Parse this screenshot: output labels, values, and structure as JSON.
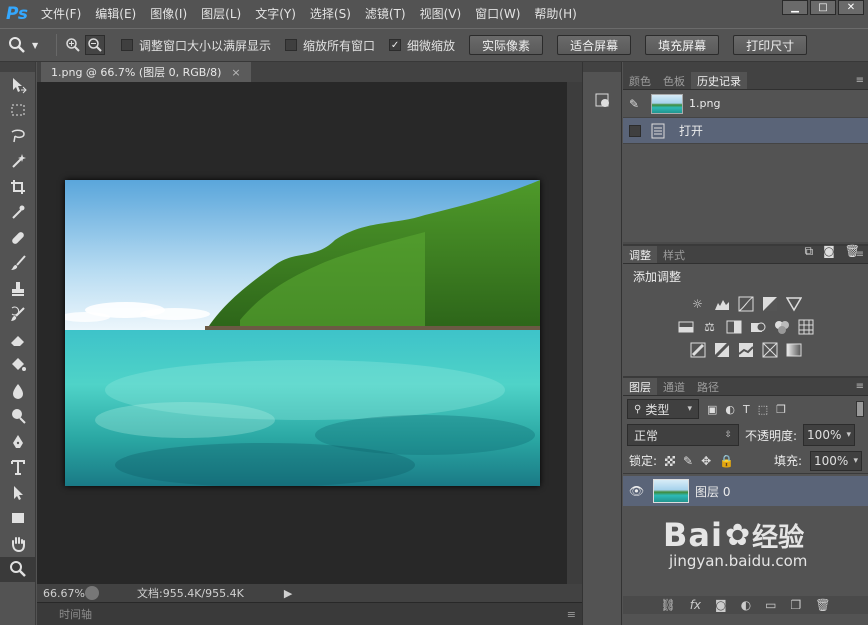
{
  "app": {
    "logo": "Ps"
  },
  "menu": [
    "文件(F)",
    "编辑(E)",
    "图像(I)",
    "图层(L)",
    "文字(Y)",
    "选择(S)",
    "滤镜(T)",
    "视图(V)",
    "窗口(W)",
    "帮助(H)"
  ],
  "window_controls": {
    "minimize": "▁",
    "maximize": "□",
    "close": "✕"
  },
  "options": {
    "resize_windows": "调整窗口大小以满屏显示",
    "zoom_all": "缩放所有窗口",
    "scrubby_zoom": "细微缩放",
    "actual_pixels": "实际像素",
    "fit_screen": "适合屏幕",
    "fill_screen": "填充屏幕",
    "print_size": "打印尺寸",
    "resize_checked": false,
    "zoom_all_checked": false,
    "scrubby_checked": true
  },
  "document": {
    "tab_title": "1.png @ 66.7% (图层 0, RGB/8)",
    "zoom": "66.67%",
    "info": "文档:955.4K/955.4K"
  },
  "timeline": {
    "label": "时间轴"
  },
  "history_panel": {
    "tabs": [
      "颜色",
      "色板",
      "历史记录"
    ],
    "snapshot_name": "1.png",
    "states": [
      "打开"
    ]
  },
  "adjustments_panel": {
    "tabs": [
      "调整",
      "样式"
    ],
    "title": "添加调整"
  },
  "layers_panel": {
    "tabs": [
      "图层",
      "通道",
      "路径"
    ],
    "filter": "类型",
    "blend_mode": "正常",
    "opacity_label": "不透明度:",
    "opacity": "100%",
    "lock_label": "锁定:",
    "fill_label": "填充:",
    "fill": "100%",
    "layers": [
      {
        "name": "图层 0"
      }
    ]
  },
  "watermark": {
    "brand": "Bai",
    "brand2": "经验",
    "url": "jingyan.baidu.com"
  },
  "colors": {
    "accent": "#34a8ff",
    "selected_row": "#5a6478"
  }
}
